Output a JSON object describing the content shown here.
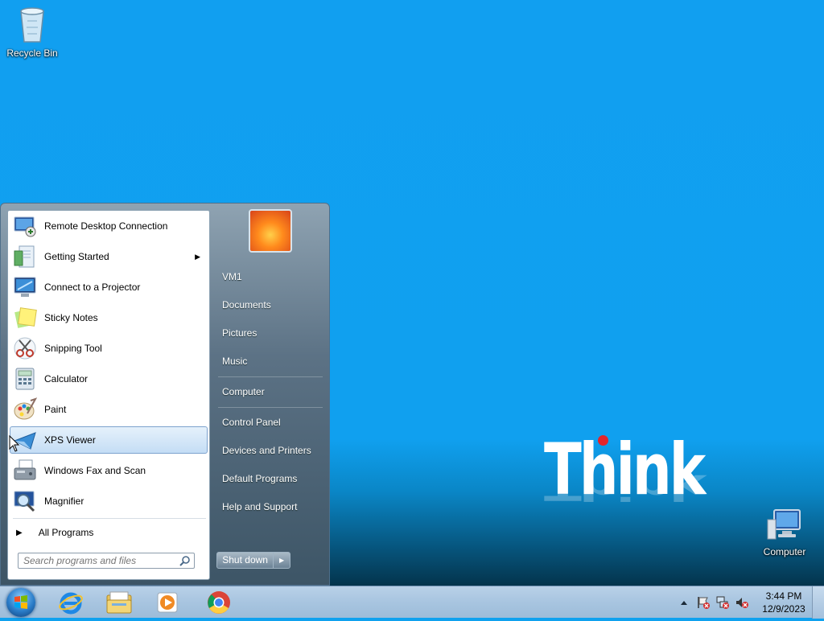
{
  "desktop": {
    "icons": [
      {
        "label": "Recycle Bin",
        "icon": "recycle-bin-icon"
      },
      {
        "label": "Computer",
        "icon": "computer-icon"
      }
    ],
    "wallpaper_logo": "Think",
    "colors": {
      "wallpaper": "#10a0ef",
      "logo_dot": "#e4252b"
    }
  },
  "start_menu": {
    "programs": [
      {
        "label": "Remote Desktop Connection",
        "icon": "remote-desktop-icon"
      },
      {
        "label": "Getting Started",
        "icon": "getting-started-icon",
        "has_submenu": true
      },
      {
        "label": "Connect to a Projector",
        "icon": "projector-icon"
      },
      {
        "label": "Sticky Notes",
        "icon": "sticky-notes-icon"
      },
      {
        "label": "Snipping Tool",
        "icon": "snipping-tool-icon"
      },
      {
        "label": "Calculator",
        "icon": "calculator-icon"
      },
      {
        "label": "Paint",
        "icon": "paint-icon"
      },
      {
        "label": "XPS Viewer",
        "icon": "xps-viewer-icon",
        "selected": true
      },
      {
        "label": "Windows Fax and Scan",
        "icon": "fax-scan-icon"
      },
      {
        "label": "Magnifier",
        "icon": "magnifier-icon"
      }
    ],
    "all_programs": "All Programs",
    "search": {
      "placeholder": "Search programs and files",
      "value": ""
    },
    "right_items": [
      {
        "label": "VM1"
      },
      {
        "label": "Documents"
      },
      {
        "label": "Pictures"
      },
      {
        "label": "Music"
      },
      {
        "label": "Computer"
      },
      {
        "label": "Control Panel"
      },
      {
        "label": "Devices and Printers"
      },
      {
        "label": "Default Programs"
      },
      {
        "label": "Help and Support"
      }
    ],
    "shutdown_label": "Shut down"
  },
  "taskbar": {
    "pinned": [
      {
        "name": "internet-explorer-icon"
      },
      {
        "name": "file-explorer-icon"
      },
      {
        "name": "media-player-icon"
      },
      {
        "name": "chrome-icon"
      }
    ],
    "tray": {
      "time": "3:44 PM",
      "date": "12/9/2023"
    }
  }
}
